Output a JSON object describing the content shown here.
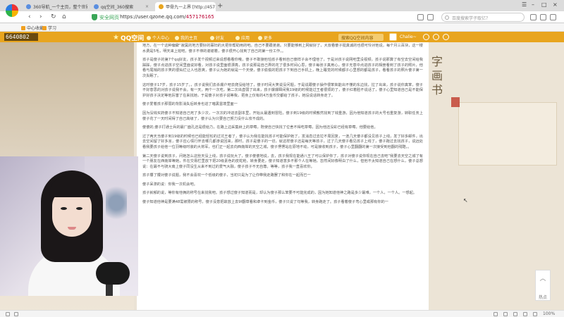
{
  "browser": {
    "tabs": [
      {
        "label": "360导航_一个主页，整个世界"
      },
      {
        "label": "qq空间_360搜索"
      },
      {
        "label": "甲骨九一上界 [http://45717..."
      }
    ],
    "window_controls": [
      "☰",
      "–",
      "□",
      "×"
    ],
    "address": {
      "secure_label": "安全网页",
      "url_prefix": "https://user.qzone.qq.com/",
      "url_highlight": "457176165"
    },
    "search_placeholder": "百度搜索学子取亿？",
    "bookmarks": [
      {
        "label": "中心收藏"
      },
      {
        "label": "学习"
      }
    ],
    "zoom": "100%"
  },
  "qzone": {
    "logo_text": "QQ空间",
    "nav": [
      {
        "label": "个人中心"
      },
      {
        "label": "我的主页"
      },
      {
        "label": "好友"
      },
      {
        "label": "应用"
      },
      {
        "label": "更多"
      }
    ],
    "search_placeholder": "搜索QQ空间内容",
    "username": "Chalie~"
  },
  "stream": {
    "counter": "6640802"
  },
  "article": {
    "paragraphs": [
      "地方，在一个这种偏僻“寂寞的地方要好的寡妇的大把你帮助用的吧。自己不要跟弟弟。只要能够到上网就好了，大叔看傻子挺真诚的也很可怜对他说，每个月三百块，这一楼水费是5毛，明天来上班吧。傻子不停的谢谢着，傻子很开心找到了自己的第一份工作，。",
      "孩子是傻子的第7个qq好友，孩子发个视频过来说想看看你哦，傻子不敢接他怕孩子看到自己傻样子会不理他了，于是对孩子说网吧里没视频，孩子说那算了有空去空间给我踩踩，傻子点进孩子空间里面说好看，对孩子说里面很漂亮，孩子说那是自己弄的花了很多时间心思，傻子每张子真用心，傻子无意中点进孩子的相册看到了孩子的照片，他看与尾梢的孩子笑的很灿烂让人也愿爽，傻子认为她的就是一个天使，傻子偷偷的把孩子下到自己手机上，晚上睡觉的时候都子心里想的都是孩子，看看孩子的照片傻子第一次失眠了。",
      "这时傻子17岁，孩子15岁了。，孩子说我们去杀爆户吧去爬没给地了，傻子时间大笑说没问题，于是说跟傻子操作很笨拙能出不懂的东边找，拉了出来，孩子说你真笨，傻子不好意思的对孩子说我不会。有一天，两个一次吃，第二次出虚弱了出来，孩子爆爆瞬间我19级的时候能过王者很烦的了，傻子红着脸不说话了，傻子心里知道自己是不能保护好孩子决定等他厉害了在来找她，于是傻子对孩子说等我，把身上仅有的4万金币交都给了孩子，她没说话转身走了。",
      "傻子爱着孩子那弱的背影消失后转身也进了暗黑雷境里面一",
      "因为没钱买药傻子不知道自己死了多少次，一次次的冲进去副本里，开始从最遇到冒险，傻子到19级的时候教然找到了钱重游，因为他知道孩子的大号也重复游，转职任务上傻子花了一天时间得了自己高级了，傻子认为只要自己努力没什么攻不成的。",
      "傻傻的,傻子打通士兵的最厂面孔还是很给力，在路上边采集树上的草莓，既使自己快找了位舍不得吃草莓，因为他还没彩已经有草莓，他要给他。",
      "过了两天当傻子到19级的时候也已经能轻松的过坑王者了，傻子认为我在能找孩子可能保护她了，发消息过去拉不周回复，一连几天傻子都没见孩子上线，发了好多邮件，出去空间留了好多言，傻子应心情行怀去哪几都渗说回来，那时，孩子是傻子的一切，就这样傻子还是每天等孩子，过了几天傻子看见孩子上线了，傻子跑过去找孩子，说远处看我要孩子给他一位羽等级时装的大将军，也们正一起去向西南岸的天空之城，傻子愣愣站在原地不动，可是接收到孩子，傻子心里翻翻的第一次接受到他翻的残酷，。",
      "第二天傻子说到孩子，问她怎么这些天没上线，孩子说玩大了，傻子傻傻地说，去，孩子我现在能通八王了可以保护你了，孩子对傻子说你现在自己去吧”我要去天空之城了有一个朋友在西南岸等她，件在交易栏里放下把20级素色的皮蛇枪，转身要走，傻子知道意多不那个人在等她，忽然间好像明白了什么，但他不太知道自己在想什么，傻子总想说：在最不与骑大南上傻子同没生从来不到过的爱气大融，傻子孩子不无自尊。等等，孩子我一直喜欢你。",
      "孩子攥了攥对傻子说题，我不会喜欢一个低级的傻子，当初只是为了让你带我走路罢了和你在一起而已一",
      "傻子呆滞的说：你我一次机会吧。",
      "孩子就郁的说，等你有他俩的称号在来找我吧。孩子想过傻子知道而是，却认为傻子那么笨要不可能完成的，因为她知道他神之路是多少最难，一个人，一个人。一想起。",
      "傻子知道他神是要满48需被限的称号，傻子没意把故放上去9f翻草看和卓卡到金币，傻子只说了句等我，转身跑走了。孩子看着傻子弯心里或那有你的一"
    ]
  },
  "sidebar": {
    "hot_label": "热点"
  }
}
